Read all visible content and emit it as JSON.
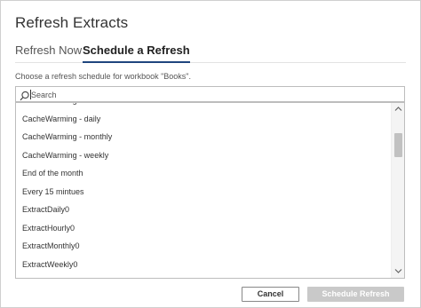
{
  "dialog": {
    "title": "Refresh Extracts"
  },
  "tabs": {
    "refresh_now": "Refresh Now",
    "schedule": "Schedule a Refresh",
    "active": "schedule"
  },
  "instruction": "Choose a refresh schedule for workbook \"Books\".",
  "search": {
    "value": "",
    "placeholder": "Search"
  },
  "schedules": [
    "CacheWarming - Caboose",
    "CacheWarming - daily",
    "CacheWarming - monthly",
    "CacheWarming - weekly",
    "End of the month",
    "Every 15 mintues",
    "ExtractDaily0",
    "ExtractHourly0",
    "ExtractMonthly0",
    "ExtractWeekly0"
  ],
  "buttons": {
    "cancel": "Cancel",
    "schedule_refresh": "Schedule Refresh"
  },
  "colors": {
    "active_tab_underline": "#1f457e",
    "disabled_button": "#c9c9c9"
  },
  "icons": {
    "search": "magnifier-icon",
    "scroll_up": "chevron-up-icon",
    "scroll_down": "chevron-down-icon"
  }
}
